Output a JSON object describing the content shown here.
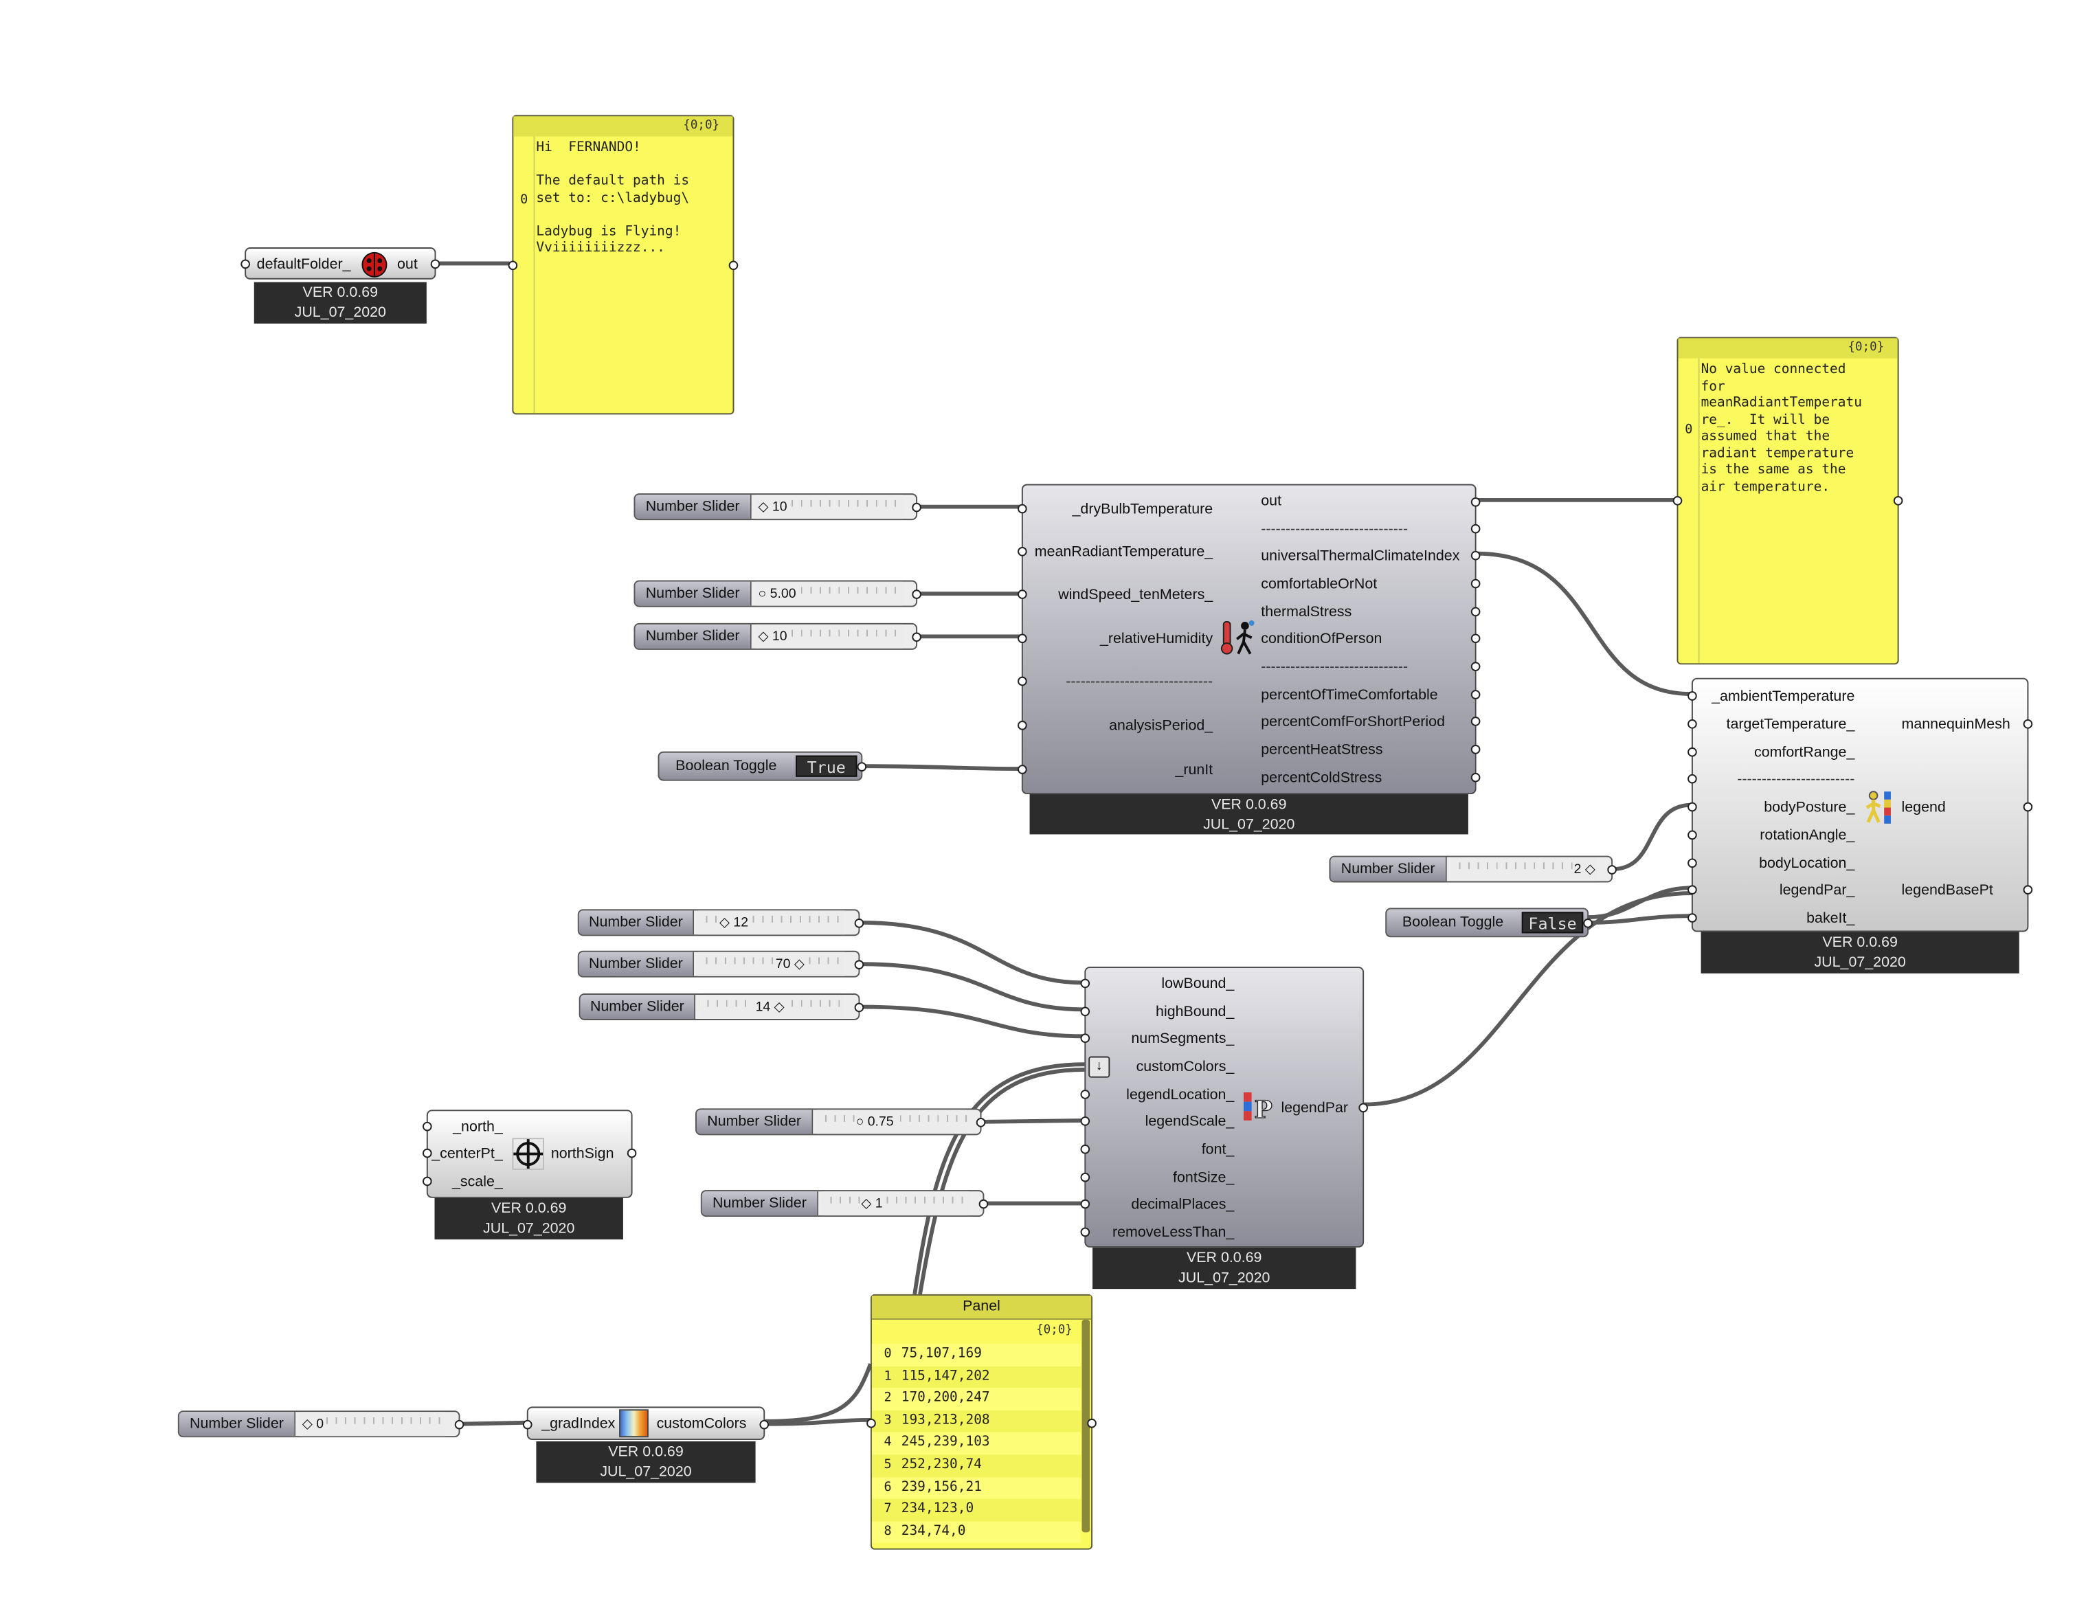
{
  "version_label": "VER 0.0.69",
  "date_label": "JUL_07_2020",
  "default_folder": {
    "input": "defaultFolder_",
    "output": "out"
  },
  "panel_welcome": {
    "path": "{0;0}",
    "index": "0",
    "text": "Hi  FERNANDO!\n\nThe default path is\nset to: c:\\ladybug\\\n\nLadybug is Flying!\nVviiiiiiiizzz..."
  },
  "panel_mrt": {
    "path": "{0;0}",
    "index": "0",
    "text": "No value connected\nfor\nmeanRadiantTemperatu\nre_.  It will be\nassumed that the\nradiant temperature\nis the same as the\nair temperature."
  },
  "utci": {
    "inputs": [
      "_dryBulbTemperature",
      "meanRadiantTemperature_",
      "windSpeed_tenMeters_",
      "_relativeHumidity",
      "------------------------------",
      "analysisPeriod_",
      "_runIt"
    ],
    "outputs": [
      "out",
      "------------------------------",
      "universalThermalClimateIndex",
      "comfortableOrNot",
      "thermalStress",
      "conditionOfPerson",
      "------------------------------",
      "percentOfTimeComfortable",
      "percentComfForShortPeriod",
      "percentHeatStress",
      "percentColdStress"
    ]
  },
  "mannequin": {
    "inputs": [
      "_ambientTemperature",
      "targetTemperature_",
      "comfortRange_",
      "------------------------",
      "bodyPosture_",
      "rotationAngle_",
      "bodyLocation_",
      "legendPar_",
      "bakeIt_"
    ],
    "outputs": [
      "mannequinMesh",
      "legend",
      "legendBasePt"
    ]
  },
  "legendpar": {
    "inputs": [
      "lowBound_",
      "highBound_",
      "numSegments_",
      "customColors_",
      "legendLocation_",
      "legendScale_",
      "font_",
      "fontSize_",
      "decimalPlaces_",
      "removeLessThan_"
    ],
    "output": "legendPar"
  },
  "northarrow": {
    "inputs": [
      "_north_",
      "_centerPt_",
      "_scale_"
    ],
    "output": "northSign"
  },
  "gradient": {
    "input": "_gradIndex",
    "output": "customColors"
  },
  "sliders": {
    "name": "Number Slider",
    "drybulb": "◇ 10",
    "wind": "○ 5.00",
    "rh": "◇ 10",
    "posture": "2 ◇",
    "low": "◇ 12",
    "high": "70 ◇",
    "segments": "14 ◇",
    "scale": "○ 0.75",
    "decimals": "◇ 1",
    "grad": "◇ 0"
  },
  "toggles": {
    "name": "Boolean Toggle",
    "run": "True",
    "bake": "False"
  },
  "colors_panel": {
    "title": "Panel",
    "path": "{0;0}",
    "rows": [
      "75,107,169",
      "115,147,202",
      "170,200,247",
      "193,213,208",
      "245,239,103",
      "252,230,74",
      "239,156,21",
      "234,123,0",
      "234,74,0"
    ],
    "indices": [
      "0",
      "1",
      "2",
      "3",
      "4",
      "5",
      "6",
      "7",
      "8"
    ]
  }
}
